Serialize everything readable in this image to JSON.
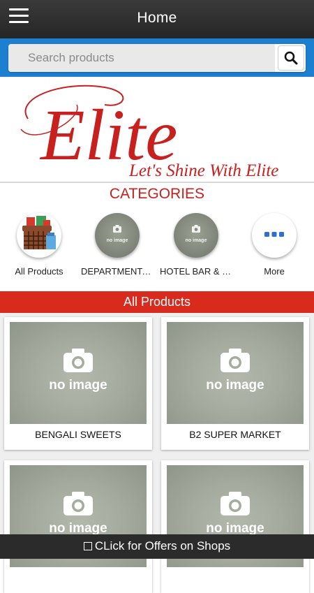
{
  "header": {
    "title": "Home",
    "menu_icon": "hamburger-icon"
  },
  "search": {
    "placeholder": "Search products",
    "value": "",
    "icon": "search-icon"
  },
  "banner": {
    "brand": "Elite",
    "tagline": "Let's Shine With Elite",
    "brand_color": "#c8201e"
  },
  "categories": {
    "title": "CATEGORIES",
    "items": [
      {
        "label": "All Products",
        "image": "all-products-icon"
      },
      {
        "label": "DEPARTMENTA…",
        "image": "no-image-placeholder",
        "image_text": "no image"
      },
      {
        "label": "HOTEL BAR & R…",
        "image": "no-image-placeholder",
        "image_text": "no image"
      },
      {
        "label": "More",
        "image": "more-dots-icon"
      }
    ]
  },
  "section": {
    "title": "All Products",
    "color": "#d92a1e"
  },
  "products": [
    {
      "name": "BENGALI SWEETS",
      "image_text": "no image"
    },
    {
      "name": "B2 SUPER MARKET",
      "image_text": "no image"
    },
    {
      "name": "",
      "image_text": "no image"
    },
    {
      "name": "",
      "image_text": "no image"
    }
  ],
  "footer": {
    "label": "CLick for Offers on Shops",
    "icon": "offers-icon"
  }
}
